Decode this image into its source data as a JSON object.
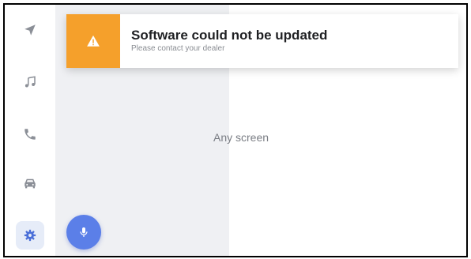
{
  "notification": {
    "title": "Software could not be updated",
    "subtitle": "Please contact your dealer",
    "icon": "warning-triangle-icon",
    "accent_color": "#f5a02b"
  },
  "main": {
    "screen_label": "Any screen"
  },
  "sidebar": {
    "items": [
      {
        "id": "navigation",
        "icon": "navigation-arrow-icon",
        "active": false
      },
      {
        "id": "music",
        "icon": "music-note-icon",
        "active": false
      },
      {
        "id": "phone",
        "icon": "phone-icon",
        "active": false
      },
      {
        "id": "vehicle",
        "icon": "car-icon",
        "active": false
      },
      {
        "id": "settings",
        "icon": "gear-icon",
        "active": true
      }
    ],
    "icon_color": "#8b8f97",
    "active_icon_color": "#4a6fd8"
  },
  "voice": {
    "icon": "microphone-icon",
    "color": "#5b7fe8"
  }
}
